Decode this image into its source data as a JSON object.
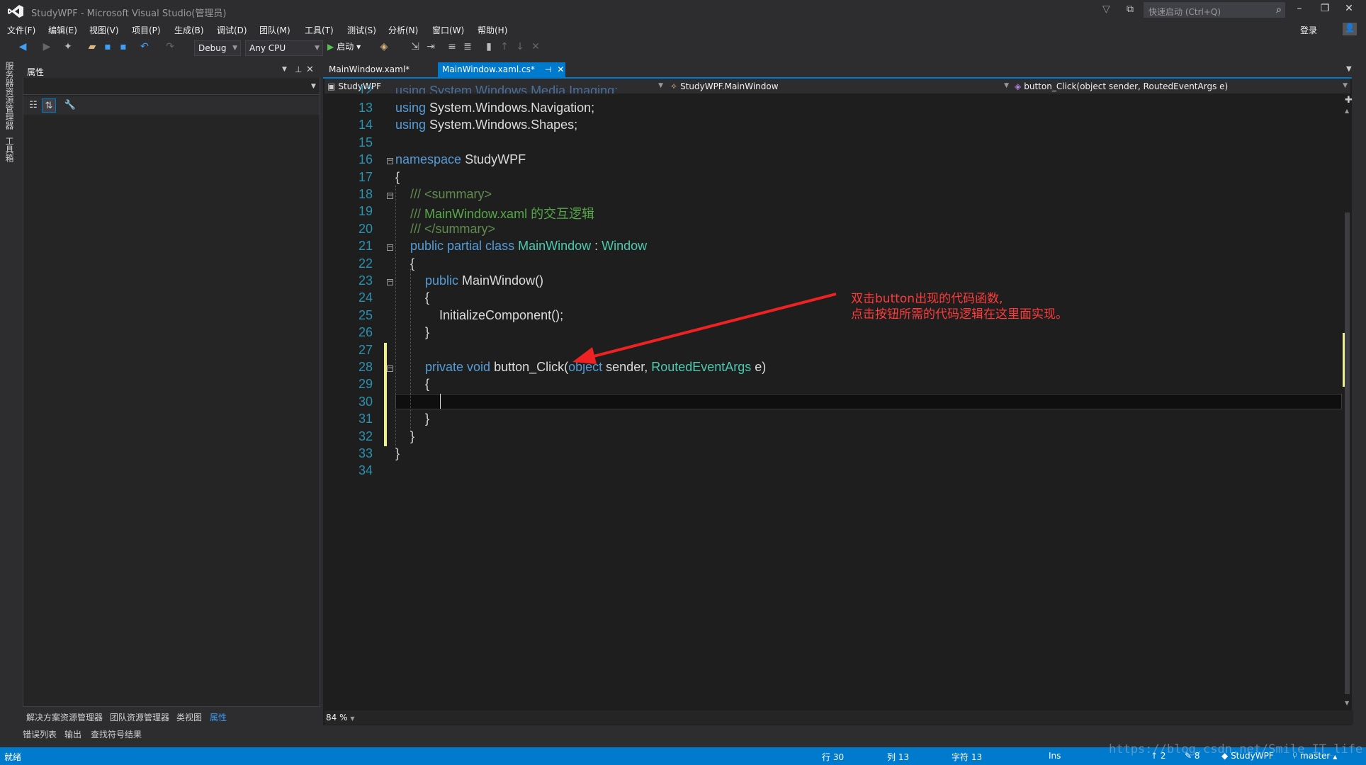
{
  "window": {
    "title": "StudyWPF - Microsoft Visual Studio(管理员)",
    "quick_launch_placeholder": "快速启动 (Ctrl+Q)",
    "login": "登录"
  },
  "menu": [
    "文件(F)",
    "编辑(E)",
    "视图(V)",
    "项目(P)",
    "生成(B)",
    "调试(D)",
    "团队(M)",
    "工具(T)",
    "测试(S)",
    "分析(N)",
    "窗口(W)",
    "帮助(H)"
  ],
  "toolbar": {
    "config": "Debug",
    "platform": "Any CPU",
    "start": "启动"
  },
  "left_strip": [
    "服务器资源管理器",
    "工具箱"
  ],
  "properties": {
    "title": "属性"
  },
  "bottom_tabs": [
    "解决方案资源管理器",
    "团队资源管理器",
    "类视图",
    "属性"
  ],
  "output_tabs": [
    "错误列表",
    "输出",
    "查找符号结果"
  ],
  "editor": {
    "tabs": [
      {
        "label": "MainWindow.xaml*"
      },
      {
        "label": "MainWindow.xaml.cs*"
      }
    ],
    "nav": {
      "project": "StudyWPF",
      "type": "StudyWPF.MainWindow",
      "member": "button_Click(object sender, RoutedEventArgs e)"
    },
    "zoom": "84 %"
  },
  "code": {
    "partial_line": "using System.Windows.Media.Imaging;",
    "line_numbers": [
      "12",
      "13",
      "14",
      "15",
      "16",
      "17",
      "18",
      "19",
      "20",
      "21",
      "22",
      "23",
      "24",
      "25",
      "26",
      "27",
      "28",
      "29",
      "30",
      "31",
      "32",
      "33",
      "34"
    ],
    "l13_kw": "using",
    "l13_rest": " System.Windows.Navigation;",
    "l14_kw": "using",
    "l14_rest": " System.Windows.Shapes;",
    "l16_kw": "namespace",
    "l16_rest": " StudyWPF",
    "l17": "{",
    "l18_c1": "/// ",
    "l18_c2": "<summary>",
    "l19_c1": "/// ",
    "l19_c2": "MainWindow.xaml 的交互逻辑",
    "l20_c1": "/// ",
    "l20_c2": "</summary>",
    "l21_kw": "public partial class ",
    "l21_ty1": "MainWindow",
    "l21_mid": " : ",
    "l21_ty2": "Window",
    "l22": "{",
    "l23_kw": "public ",
    "l23_rest": "MainWindow()",
    "l24": "{",
    "l25": "InitializeComponent();",
    "l26": "}",
    "l28_kw": "private void ",
    "l28_name": "button_Click(",
    "l28_kw2": "object",
    "l28_mid": " sender, ",
    "l28_ty": "RoutedEventArgs",
    "l28_end": " e)",
    "l29": "{",
    "l31": "}",
    "l32": "}",
    "l33": "}"
  },
  "annotation": {
    "line1": "双击button出现的代码函数,",
    "line2": "点击按钮所需的代码逻辑在这里面实现。",
    "color": "#ff3b3b"
  },
  "status": {
    "ready": "就绪",
    "row": "行 30",
    "col": "列 13",
    "char": "字符 13",
    "mode": "Ins",
    "up_count": "2",
    "edit_count": "8",
    "repo": "StudyWPF",
    "branch": "master"
  },
  "watermark": "https://blog.csdn.net/Smile_IT_life"
}
